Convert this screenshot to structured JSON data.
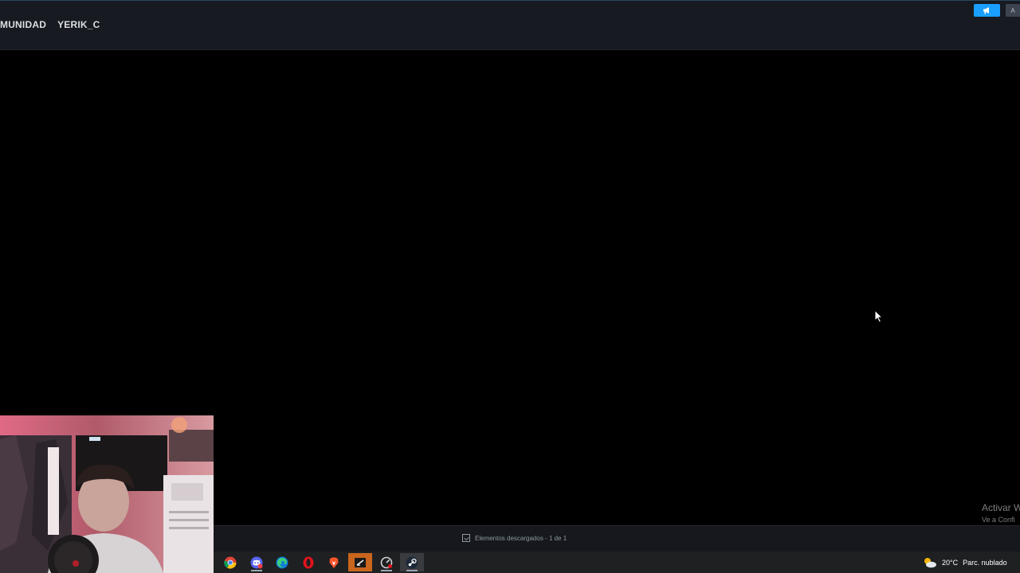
{
  "header": {
    "nav_items": [
      {
        "label": "MUNIDAD"
      },
      {
        "label": "YERIK_C"
      }
    ],
    "announce_icon": "megaphone-icon",
    "corner_label": "A",
    "accent_color": "#1a9fff"
  },
  "watermark": {
    "title": "Activar W",
    "subtitle": "Ve a Confi"
  },
  "statusbar": {
    "downloads_text": "Elementos descargados - 1 de 1",
    "icon": "download-icon"
  },
  "taskbar": {
    "apps": [
      "chrome-icon",
      "discord-icon",
      "edge-icon",
      "opera-icon",
      "brave-icon",
      "editor-icon",
      "speedtest-icon",
      "steam-icon"
    ],
    "weather_icon": "partly-cloudy-icon",
    "temperature": "20°C",
    "weather_text": "Parc. nublado"
  },
  "webcam": {
    "description_icon": "webcam-feed"
  }
}
